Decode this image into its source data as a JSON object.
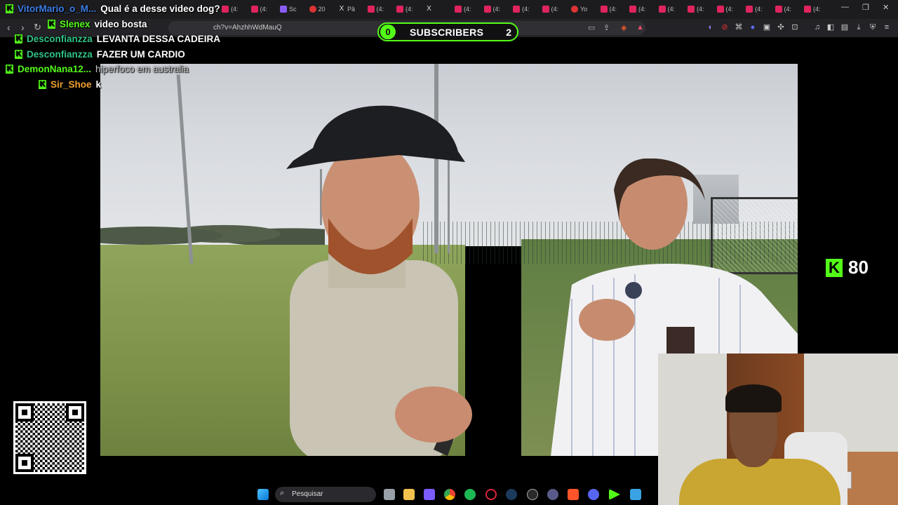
{
  "browser": {
    "tabs": [
      {
        "label": "(4:",
        "fav": "yt"
      },
      {
        "label": "(4:",
        "fav": "yt"
      },
      {
        "label": "Sc",
        "fav": "purple"
      },
      {
        "label": "20",
        "fav": "red"
      },
      {
        "label": "Pâ",
        "fav": "x"
      },
      {
        "label": "(4:",
        "fav": "yt"
      },
      {
        "label": "(4:",
        "fav": "yt"
      },
      {
        "label": "",
        "fav": "x"
      },
      {
        "label": "(4:",
        "fav": "yt"
      },
      {
        "label": "(4:",
        "fav": "yt"
      },
      {
        "label": "(4:",
        "fav": "yt"
      },
      {
        "label": "(4:",
        "fav": "yt"
      },
      {
        "label": "Yo",
        "fav": "red"
      },
      {
        "label": "(4:",
        "fav": "yt"
      },
      {
        "label": "(4:",
        "fav": "yt"
      },
      {
        "label": "(4:",
        "fav": "yt"
      },
      {
        "label": "(4:",
        "fav": "yt"
      },
      {
        "label": "(4:",
        "fav": "yt"
      },
      {
        "label": "(4:",
        "fav": "yt"
      },
      {
        "label": "(4:",
        "fav": "yt"
      },
      {
        "label": "(4:",
        "fav": "yt"
      }
    ],
    "url_fragment": "ch?v=AhzhhWdMauQ",
    "new_tab": "+",
    "win_minimize": "—",
    "win_restore": "❐",
    "win_close": "✕"
  },
  "chat": [
    {
      "user": "VitorMario_o_M...",
      "message": "Qual é a desse video dog?",
      "color": "#3d7ee6"
    },
    {
      "user": "Slenex",
      "message": "video bosta",
      "color": "#53fc18"
    },
    {
      "user": "Desconfianzza",
      "message": "LEVANTA DESSA CADEIRA",
      "color": "#2fc486"
    },
    {
      "user": "Desconfianzza",
      "message": "FAZER UM CARDIO",
      "color": "#2fc486"
    },
    {
      "user": "DemonNana12...",
      "message": "hiperfoco em australia",
      "color": "#53fc18"
    },
    {
      "user": "Sir_Shoe",
      "message": "k",
      "color": "#f0a030"
    }
  ],
  "subscribers": {
    "left_count": "0",
    "label": "SUBSCRIBERS",
    "right_count": "2"
  },
  "kick_counter": {
    "logo": "K",
    "count": "80"
  },
  "taskbar": {
    "search_placeholder": "Pesquisar"
  },
  "icons": {
    "back": "‹",
    "forward": "›",
    "reload": "↻",
    "search": "⌕",
    "kick_badge": "K"
  }
}
